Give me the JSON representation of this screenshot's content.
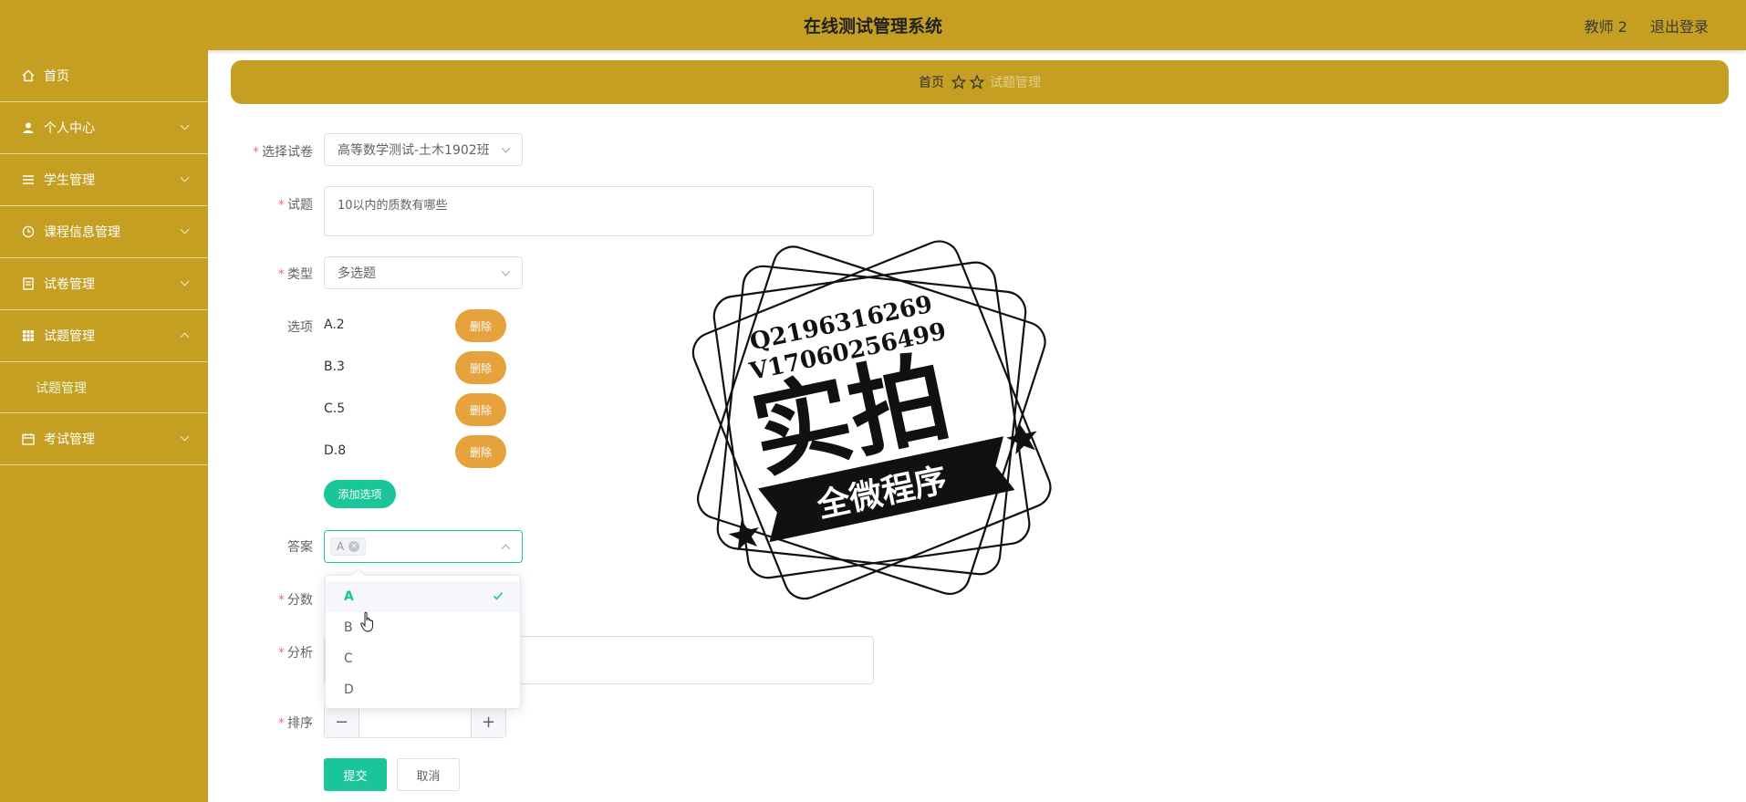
{
  "header": {
    "title": "在线测试管理系统",
    "user": "教师 2",
    "logout": "退出登录"
  },
  "sidebar": {
    "items": [
      {
        "label": "首页",
        "icon": "home-icon"
      },
      {
        "label": "个人中心",
        "icon": "user-icon"
      },
      {
        "label": "学生管理",
        "icon": "list-icon"
      },
      {
        "label": "课程信息管理",
        "icon": "clock-icon"
      },
      {
        "label": "试卷管理",
        "icon": "doc-icon"
      },
      {
        "label": "试题管理",
        "icon": "grid-icon"
      },
      {
        "label": "考试管理",
        "icon": "calendar-icon"
      }
    ],
    "sub_item": "试题管理"
  },
  "breadcrumb": {
    "home": "首页",
    "current": "试题管理"
  },
  "form": {
    "paper_label": "选择试卷",
    "paper_value": "高等数学测试-土木1902班",
    "question_label": "试题",
    "question_value": "10以内的质数有哪些",
    "type_label": "类型",
    "type_value": "多选题",
    "options_label": "选项",
    "options": [
      "A.2",
      "B.3",
      "C.5",
      "D.8"
    ],
    "delete_label": "删除",
    "add_option": "添加选项",
    "answer_label": "答案",
    "answer_tag": "A",
    "score_label": "分数",
    "analysis_label": "分析",
    "sort_label": "排序",
    "submit": "提交",
    "cancel": "取消"
  },
  "dropdown": {
    "options": [
      "A",
      "B",
      "C",
      "D"
    ],
    "selected": "A"
  },
  "stamp": {
    "line1": "Q2196316269",
    "line2": "V17060256499",
    "big": "实拍",
    "banner": "全微程序"
  },
  "colors": {
    "primary": "#c59f22",
    "accent": "#1bc59a",
    "danger": "#e6a23c"
  }
}
